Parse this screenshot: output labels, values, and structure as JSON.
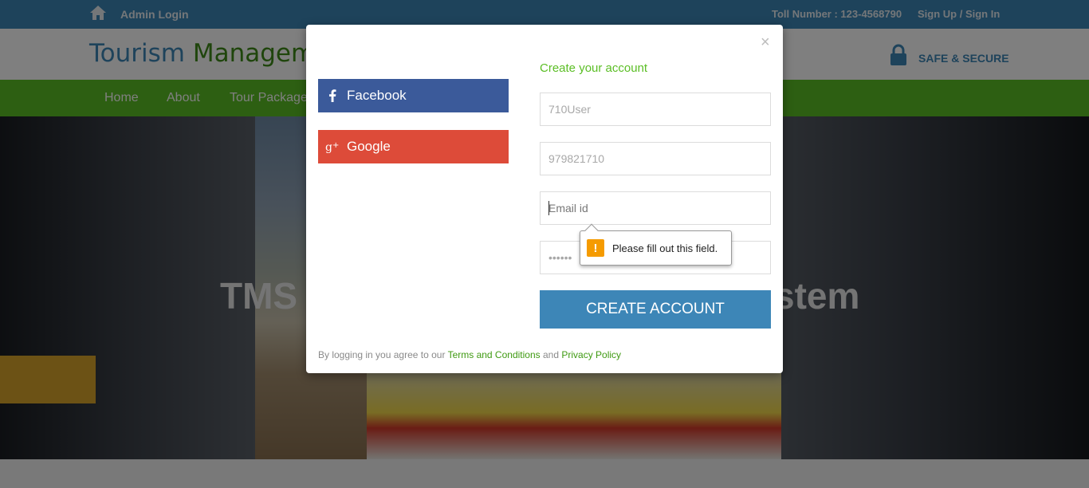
{
  "topbar": {
    "admin_login": "Admin Login",
    "toll_number": "Toll Number : 123-4568790",
    "signup_signin": "Sign Up / Sign In"
  },
  "header": {
    "brand_word1": "Tourism",
    "brand_word2": "Management",
    "secure_label": "SAFE & SECURE"
  },
  "nav": {
    "items": [
      "Home",
      "About",
      "Tour Packages"
    ]
  },
  "hero": {
    "headline_left": "TMS",
    "headline_right": "stem"
  },
  "modal": {
    "close_glyph": "×",
    "facebook_label": "Facebook",
    "google_label": "Google",
    "form_title": "Create your account",
    "fields": {
      "name_placeholder": "710User",
      "mobile_placeholder": "979821710",
      "email_placeholder": "Email id",
      "password_placeholder": "••••••"
    },
    "create_label": "CREATE ACCOUNT",
    "terms_prefix": "By logging in you agree to our",
    "terms_link": "Terms and Conditions",
    "terms_and": "and",
    "privacy_link": "Privacy Policy"
  },
  "validation": {
    "message": "Please fill out this field.",
    "icon_glyph": "!"
  },
  "colors": {
    "topbar": "#3d86b7",
    "nav": "#5bbe25",
    "facebook": "#3b5a9a",
    "google": "#dd4b39",
    "create_button": "#3d86b7",
    "link_green": "#3f9a12",
    "warning": "#f59b00"
  }
}
